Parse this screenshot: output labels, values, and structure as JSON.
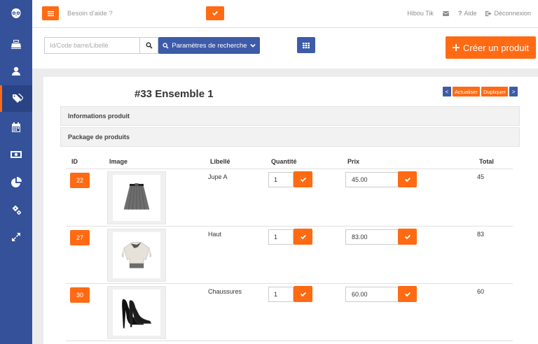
{
  "colors": {
    "sidebar": "#34519a",
    "accent": "#ff6a13",
    "primary": "#3d5ba8"
  },
  "sidebar": {
    "items": [
      {
        "icon": "owl-logo-icon"
      },
      {
        "icon": "cash-register-icon"
      },
      {
        "icon": "user-icon"
      },
      {
        "icon": "tags-icon",
        "active": true
      },
      {
        "icon": "calendar-icon"
      },
      {
        "icon": "money-icon"
      },
      {
        "icon": "pie-chart-icon"
      },
      {
        "icon": "cogs-icon"
      },
      {
        "icon": "expand-icon"
      }
    ]
  },
  "topbar": {
    "help_placeholder": "Besoin d'aide ?",
    "user_name": "Hibou Tik",
    "aide_label": "Aide",
    "logout_label": "Déconnexion"
  },
  "search": {
    "placeholder": "Id/Code barre/Libellé",
    "params_label": "Paramètres de recherche",
    "create_label": "Créer un produit"
  },
  "product": {
    "title": "#33 Ensemble 1",
    "nav": {
      "prev": "<",
      "refresh": "Actualiser",
      "duplicate": "Dupliquer",
      "next": ">"
    }
  },
  "sections": {
    "info": "Informations produit",
    "package": "Package de produits"
  },
  "table": {
    "headers": {
      "id": "ID",
      "image": "Image",
      "label": "Libellé",
      "qty": "Quantité",
      "price": "Prix",
      "total": "Total"
    },
    "rows": [
      {
        "id": "22",
        "image": "skirt",
        "label": "Jupe A",
        "qty": "1",
        "price": "45.00",
        "total": "45"
      },
      {
        "id": "27",
        "image": "sweater",
        "label": "Haut",
        "qty": "1",
        "price": "83.00",
        "total": "83"
      },
      {
        "id": "30",
        "image": "heels",
        "label": "Chaussures",
        "qty": "1",
        "price": "60.00",
        "total": "60"
      }
    ]
  }
}
